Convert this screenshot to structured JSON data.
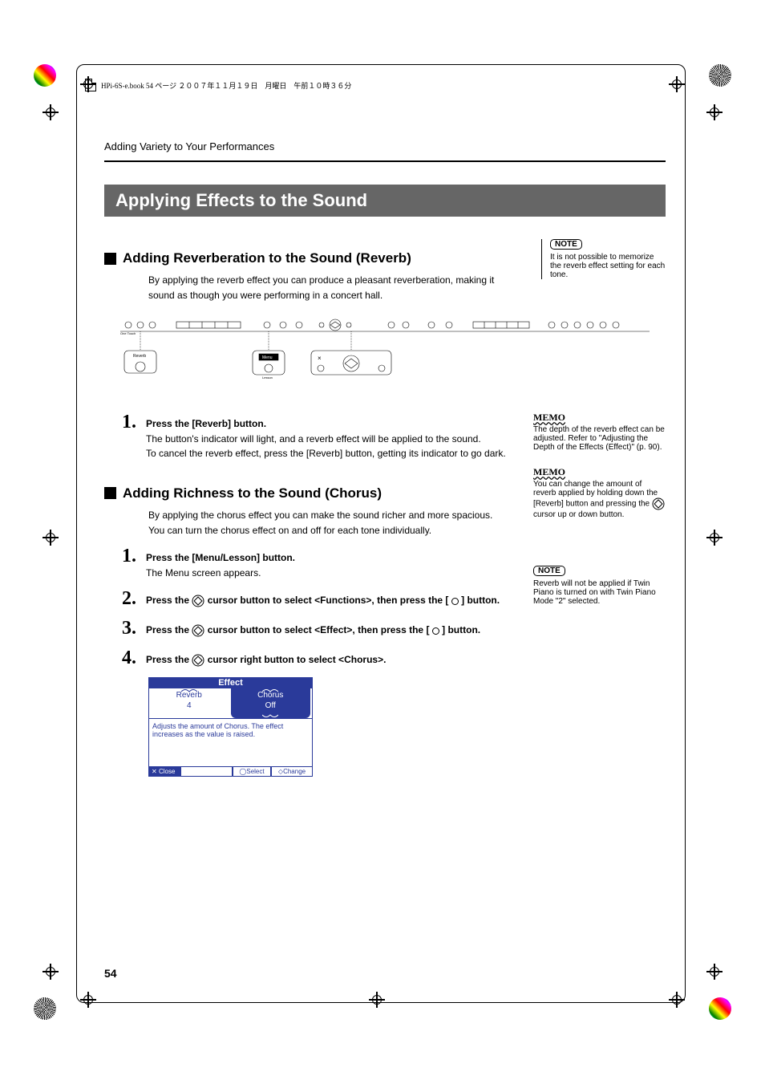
{
  "header": {
    "file_info": "HPi-6S-e.book  54 ページ  ２００７年１１月１９日　月曜日　午前１０時３６分"
  },
  "section_header": "Adding Variety to Your Performances",
  "title": "Applying Effects to the Sound",
  "reverb": {
    "heading": "Adding Reverberation to the Sound (Reverb)",
    "intro": "By applying the reverb effect you can produce a pleasant reverberation, making it sound as though you were performing in a concert hall.",
    "step1_title": "Press the [Reverb] button.",
    "step1_body1": "The button's indicator will light, and a reverb effect will be applied to the sound.",
    "step1_body2": "To cancel the reverb effect, press the [Reverb] button, getting its indicator to go dark."
  },
  "chorus": {
    "heading": "Adding Richness to the Sound (Chorus)",
    "intro1": "By applying the chorus effect you can make the sound richer and more spacious.",
    "intro2": "You can turn the chorus effect on and off for each tone individually.",
    "step1_title": "Press the [Menu/Lesson] button.",
    "step1_body": "The Menu screen appears.",
    "step2_a": "Press the ",
    "step2_b": " cursor button to select <Functions>, then press the [ ",
    "step2_c": " ] button.",
    "step3_a": "Press the ",
    "step3_b": " cursor button to select <Effect>, then press the [ ",
    "step3_c": " ] button.",
    "step4_a": "Press the ",
    "step4_b": " cursor right button to select <Chorus>."
  },
  "effect_screen": {
    "title": "Effect",
    "tab1": "Reverb",
    "tab1_val": "4",
    "tab2": "Chorus",
    "tab2_val": "Off",
    "desc": "Adjusts the amount of Chorus. The effect increases as the value is raised.",
    "close": "Close",
    "select": "Select",
    "change": "Change"
  },
  "sidebar": {
    "note1_label": "NOTE",
    "note1": "It is not possible to memorize the reverb effect setting for each tone.",
    "memo1_label": "MEMO",
    "memo1": "The depth of the reverb effect can be adjusted. Refer to \"Adjusting the Depth of the Effects (Effect)\" (p. 90).",
    "memo2_label": "MEMO",
    "memo2_a": "You can change the amount of reverb applied by holding down the [Reverb] button and pressing the ",
    "memo2_b": " cursor up or down button.",
    "note2_label": "NOTE",
    "note2": "Reverb will not be applied if Twin Piano is turned on with Twin Piano Mode \"2\" selected."
  },
  "steps": {
    "s1": "1.",
    "s2": "2.",
    "s3": "3.",
    "s4": "4."
  },
  "page_number": "54"
}
